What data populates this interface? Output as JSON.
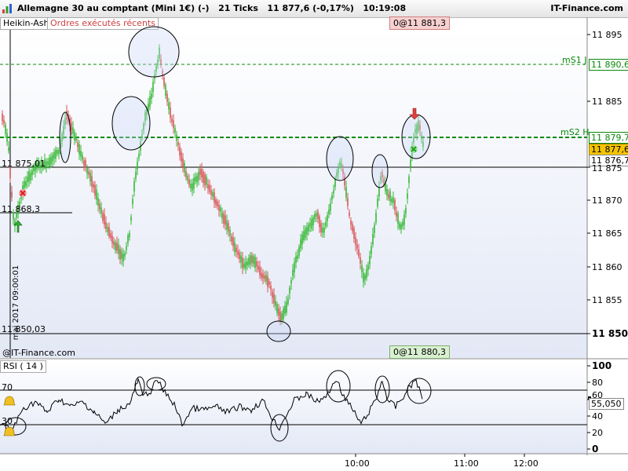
{
  "window": {
    "title": "Allemagne 30 au comptant (Mini 1€) (-)   21 Ticks   11 877,6 (-0,17%)   10:19:08",
    "brand": "IT-Finance.com"
  },
  "tabs": [
    {
      "label": "Heikin-Ashi"
    },
    {
      "label": "Ordres exécutés récents"
    }
  ],
  "tags": {
    "top_order": "0@11 881,3",
    "bottom_order": "0@11 880,3"
  },
  "watermark": "@IT-Finance.com",
  "date_marker": "mai 2017 09:00:01",
  "price_axis": {
    "ticks": [
      "11 895",
      "11 885",
      "11 875",
      "11 870",
      "11 865",
      "11 860",
      "11 855"
    ],
    "bold_tick": "11 850",
    "markers": [
      {
        "label": "mS1 J",
        "value": "11 890,6"
      },
      {
        "label": "mS2 H",
        "value": "11 879,7"
      }
    ],
    "current_price": "11 877,6",
    "secondary_price": "11 876,7"
  },
  "hlines": [
    {
      "label": "11 875,01"
    },
    {
      "label": "11 868,3"
    },
    {
      "label": "11 850,03"
    }
  ],
  "rsi": {
    "label": "RSI ( 14 )",
    "left_levels": [
      "70",
      "30"
    ],
    "ticks": [
      "100",
      "80",
      "60",
      "40",
      "20",
      "0"
    ],
    "current": "55,050"
  },
  "time_axis": [
    "10:00",
    "11:00",
    "12:00"
  ],
  "colors": {
    "up": "#33b833",
    "down": "#d85555",
    "dashed": "#0a8a0a",
    "current_bg": "#f5c400"
  }
}
